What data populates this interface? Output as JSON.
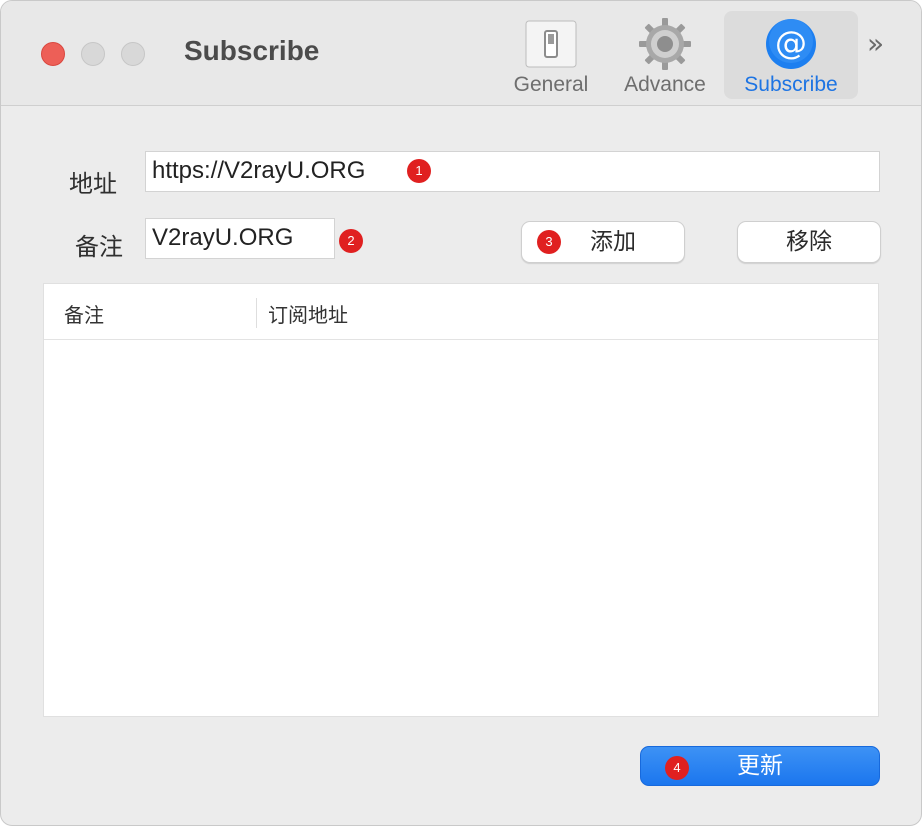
{
  "window": {
    "title": "Subscribe"
  },
  "toolbar": {
    "items": [
      {
        "label": "General",
        "icon": "switch-icon",
        "active": false
      },
      {
        "label": "Advance",
        "icon": "gear-icon",
        "active": false
      },
      {
        "label": "Subscribe",
        "icon": "at-sign-icon",
        "active": true
      }
    ],
    "overflow_icon": "chevron-double-right-icon"
  },
  "form": {
    "address_label": "地址",
    "address_value": "https://V2rayU.ORG",
    "remark_label": "备注",
    "remark_value": "V2rayU.ORG",
    "add_label": "添加",
    "remove_label": "移除"
  },
  "badges": [
    "1",
    "2",
    "3",
    "4"
  ],
  "table": {
    "columns": [
      "备注",
      "订阅地址"
    ],
    "rows": []
  },
  "footer": {
    "update_label": "更新"
  },
  "colors": {
    "accent": "#1d74e3",
    "badge": "#e02020",
    "close": "#ed5f57"
  }
}
